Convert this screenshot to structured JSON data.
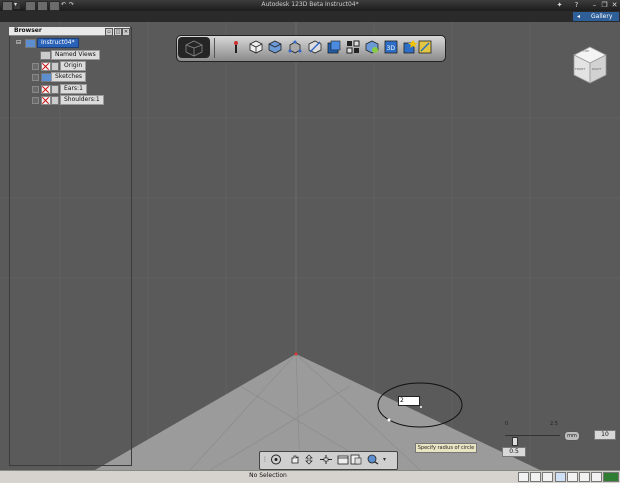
{
  "window": {
    "title": "Autodesk 123D Beta   Instruct04*"
  },
  "quick_access": [
    "app-menu-icon",
    "new-icon",
    "open-icon",
    "save-icon",
    "undo-icon",
    "redo-icon"
  ],
  "window_controls": [
    "help-icon",
    "minimize-icon",
    "restore-icon",
    "close-icon"
  ],
  "gallery": {
    "label": "Gallery"
  },
  "browser": {
    "title": "Browser",
    "root": "Instruct04*",
    "items": [
      {
        "label": "Named Views",
        "visible": true
      },
      {
        "label": "Origin",
        "visible": false
      },
      {
        "label": "Sketches",
        "visible": true
      },
      {
        "label": "Ears:1",
        "visible": false
      },
      {
        "label": "Shoulders:1",
        "visible": false
      }
    ]
  },
  "toolbar": {
    "tools": [
      "logo-cube-icon",
      "transform-icon",
      "primitives-icon",
      "sketch-icon",
      "construct-icon",
      "modify-icon",
      "pattern-icon",
      "grouping-icon",
      "combine-icon",
      "measure-icon",
      "text-icon",
      "material-icon"
    ]
  },
  "viewcube": {
    "faces": [
      "TOP",
      "FRONT",
      "RIGHT"
    ]
  },
  "sketch": {
    "radius_value": "2"
  },
  "tooltip": {
    "text": "Specify radius of circle"
  },
  "ruler": {
    "scale_label": "2.5",
    "zero_label": "0",
    "unit": "mm",
    "grid_value": "10",
    "snap_value": "0.5"
  },
  "status": {
    "text": "No Selection"
  },
  "colors": {
    "viewport": "#5a5a5a",
    "ground": "#9c9c9c",
    "accent_blue": "#2e5f98",
    "selection": "#2a62b8"
  }
}
